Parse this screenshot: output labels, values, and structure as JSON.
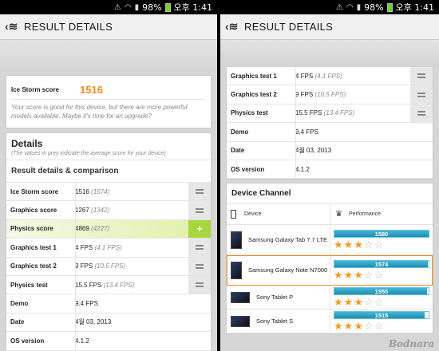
{
  "status": {
    "battery": "98%",
    "time": "오후 1:41"
  },
  "appbar": {
    "title": "RESULT DETAILS"
  },
  "left": {
    "score_label": "Ice Storm score",
    "score_value": "1516",
    "advice": "Your score is good for this device, but there are more powerful models available. Maybe it's time for an upgrade?",
    "details_title": "Details",
    "details_note": "(The values in grey indicate the average score for your device)",
    "comparison_title": "Result details & comparison",
    "rows": [
      {
        "label": "Ice Storm score",
        "value": "1516",
        "avg": "(1574)"
      },
      {
        "label": "Graphics score",
        "value": "1267",
        "avg": "(1342)"
      },
      {
        "label": "Physics score",
        "value": "4869",
        "avg": "(4227)"
      },
      {
        "label": "Graphics test 1",
        "value": "4 FPS",
        "avg": "(4.1 FPS)"
      },
      {
        "label": "Graphics test 2",
        "value": "9 FPS",
        "avg": "(10.5 FPS)"
      },
      {
        "label": "Physics test",
        "value": "15.5 FPS",
        "avg": "(13.4 FPS)"
      },
      {
        "label": "Demo",
        "value": "9.4 FPS",
        "avg": ""
      },
      {
        "label": "Date",
        "value": "4월 03, 2013",
        "avg": ""
      },
      {
        "label": "OS version",
        "value": "4.1.2",
        "avg": ""
      }
    ]
  },
  "right": {
    "rows": [
      {
        "label": "Graphics test 1",
        "value": "4 FPS",
        "avg": "(4.1 FPS)"
      },
      {
        "label": "Graphics test 2",
        "value": "9 FPS",
        "avg": "(10.5 FPS)"
      },
      {
        "label": "Physics test",
        "value": "15.5 FPS",
        "avg": "(13.4 FPS)"
      },
      {
        "label": "Demo",
        "value": "9.4 FPS",
        "avg": ""
      },
      {
        "label": "Date",
        "value": "4월 03, 2013",
        "avg": ""
      },
      {
        "label": "OS version",
        "value": "4.1.2",
        "avg": ""
      }
    ],
    "channel_title": "Device Channel",
    "col_device": "Device",
    "col_performance": "Performance",
    "devices": [
      {
        "name": "Samsung Galaxy Tab 7.7 LTE",
        "score": "1580",
        "fill": 1.0,
        "stars": 3
      },
      {
        "name": "Samsung Galaxy Note N7000",
        "score": "1574",
        "fill": 0.99,
        "stars": 3
      },
      {
        "name": "Sony Tablet P",
        "score": "1555",
        "fill": 0.98,
        "stars": 3
      },
      {
        "name": "Sony Tablet S",
        "score": "1515",
        "fill": 0.96,
        "stars": 3
      }
    ]
  },
  "watermark": "Bodnara"
}
